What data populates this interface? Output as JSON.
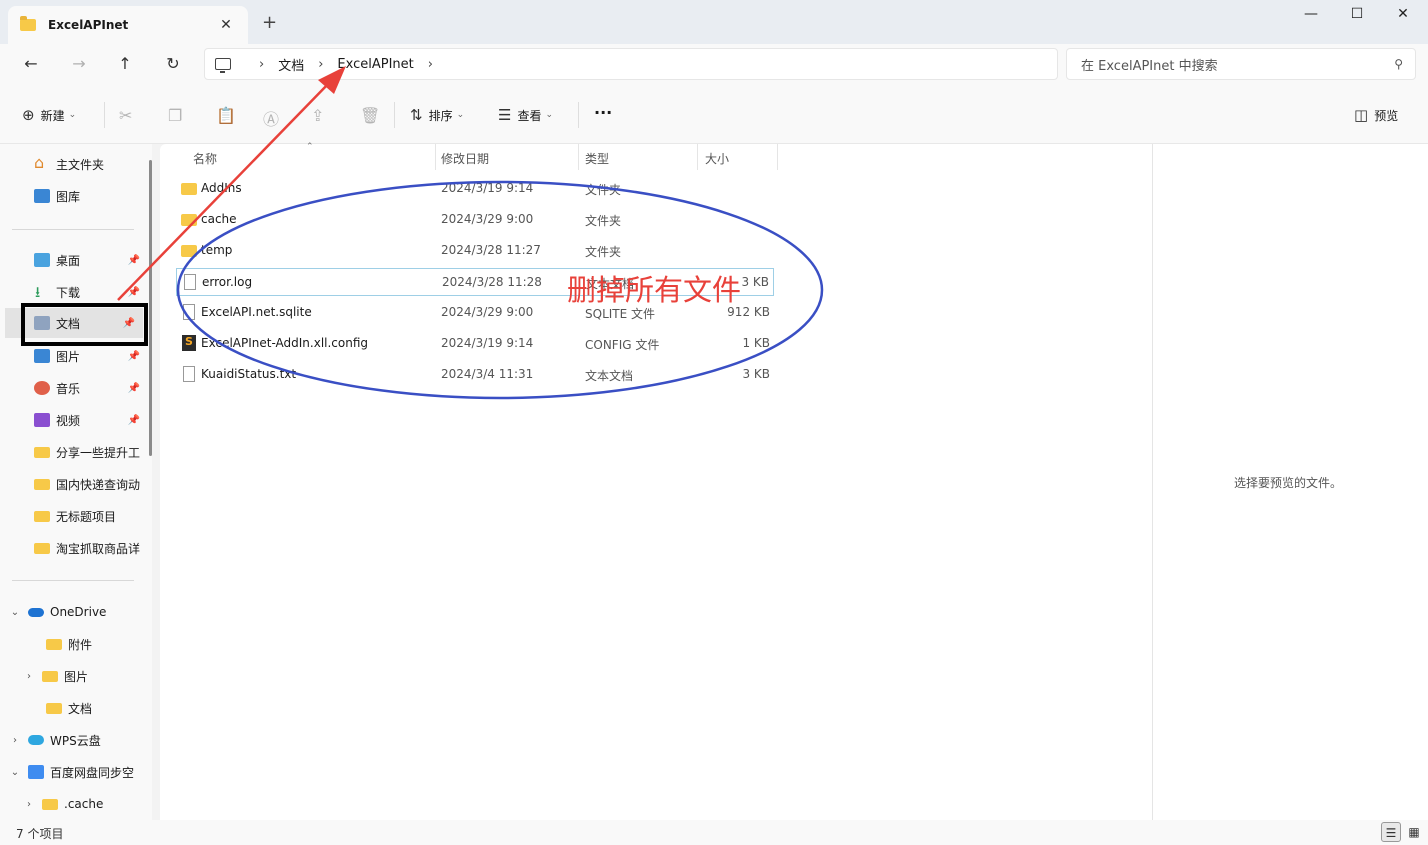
{
  "window": {
    "tab_title": "ExcelAPInet",
    "tab_close": "✕",
    "new_tab": "+",
    "minimize": "—",
    "maximize": "☐",
    "close": "✕"
  },
  "nav": {
    "back": "←",
    "forward": "→",
    "up": "↑",
    "refresh": "↻"
  },
  "address": {
    "crumbs": [
      "文档",
      "ExcelAPInet"
    ],
    "separator": "›"
  },
  "search": {
    "placeholder": "在 ExcelAPInet 中搜索"
  },
  "toolbar": {
    "new_label": "新建",
    "sort_label": "排序",
    "view_label": "查看",
    "more_label": "···",
    "preview_label": "预览"
  },
  "sidebar": {
    "quick": [
      {
        "label": "主文件夹",
        "icon": "home-icon"
      },
      {
        "label": "图库",
        "icon": "gallery-icon"
      }
    ],
    "pinned": [
      {
        "label": "桌面",
        "icon": "desktop-icon"
      },
      {
        "label": "下载",
        "icon": "download-icon"
      },
      {
        "label": "文档",
        "icon": "documents-icon"
      },
      {
        "label": "图片",
        "icon": "pictures-icon"
      },
      {
        "label": "音乐",
        "icon": "music-icon"
      },
      {
        "label": "视频",
        "icon": "videos-icon"
      },
      {
        "label": "分享一些提升工",
        "icon": "folder-icon"
      },
      {
        "label": "国内快递查询动",
        "icon": "folder-icon"
      },
      {
        "label": "无标题项目",
        "icon": "folder-icon"
      },
      {
        "label": "淘宝抓取商品详",
        "icon": "folder-icon"
      }
    ],
    "tree": [
      {
        "label": "OneDrive",
        "icon": "onedrive-icon",
        "chevron": "⌄"
      },
      {
        "label": "附件",
        "icon": "folder-icon",
        "chevron": ""
      },
      {
        "label": "图片",
        "icon": "folder-icon",
        "chevron": "›"
      },
      {
        "label": "文档",
        "icon": "folder-icon",
        "chevron": ""
      },
      {
        "label": "WPS云盘",
        "icon": "wps-cloud-icon",
        "chevron": "›"
      },
      {
        "label": "百度网盘同步空",
        "icon": "baidu-netdisk-icon",
        "chevron": "⌄"
      },
      {
        "label": ".cache",
        "icon": "folder-icon",
        "chevron": "›"
      }
    ],
    "selected": "文档"
  },
  "columns": {
    "name": "名称",
    "date": "修改日期",
    "type": "类型",
    "size": "大小"
  },
  "files": [
    {
      "name": "AddIns",
      "date": "2024/3/19 9:14",
      "type": "文件夹",
      "size": "",
      "icon": "folder"
    },
    {
      "name": "cache",
      "date": "2024/3/29 9:00",
      "type": "文件夹",
      "size": "",
      "icon": "folder"
    },
    {
      "name": "temp",
      "date": "2024/3/28 11:27",
      "type": "文件夹",
      "size": "",
      "icon": "folder"
    },
    {
      "name": "error.log",
      "date": "2024/3/28 11:28",
      "type": "文本文档",
      "size": "3 KB",
      "icon": "doc"
    },
    {
      "name": "ExcelAPI.net.sqlite",
      "date": "2024/3/29 9:00",
      "type": "SQLITE 文件",
      "size": "912 KB",
      "icon": "doc"
    },
    {
      "name": "ExcelAPInet-AddIn.xll.config",
      "date": "2024/3/19 9:14",
      "type": "CONFIG 文件",
      "size": "1 KB",
      "icon": "cfg"
    },
    {
      "name": "KuaidiStatus.txt",
      "date": "2024/3/4 11:31",
      "type": "文本文档",
      "size": "3 KB",
      "icon": "doc"
    }
  ],
  "annotation": {
    "text": "删掉所有文件",
    "text_color": "#e8413a",
    "ellipse_color": "#3a4fc4",
    "arrow_color": "#e8413a",
    "box_color": "#000000"
  },
  "preview": {
    "empty_text": "选择要预览的文件。"
  },
  "status": {
    "count_text": "7 个项目"
  }
}
